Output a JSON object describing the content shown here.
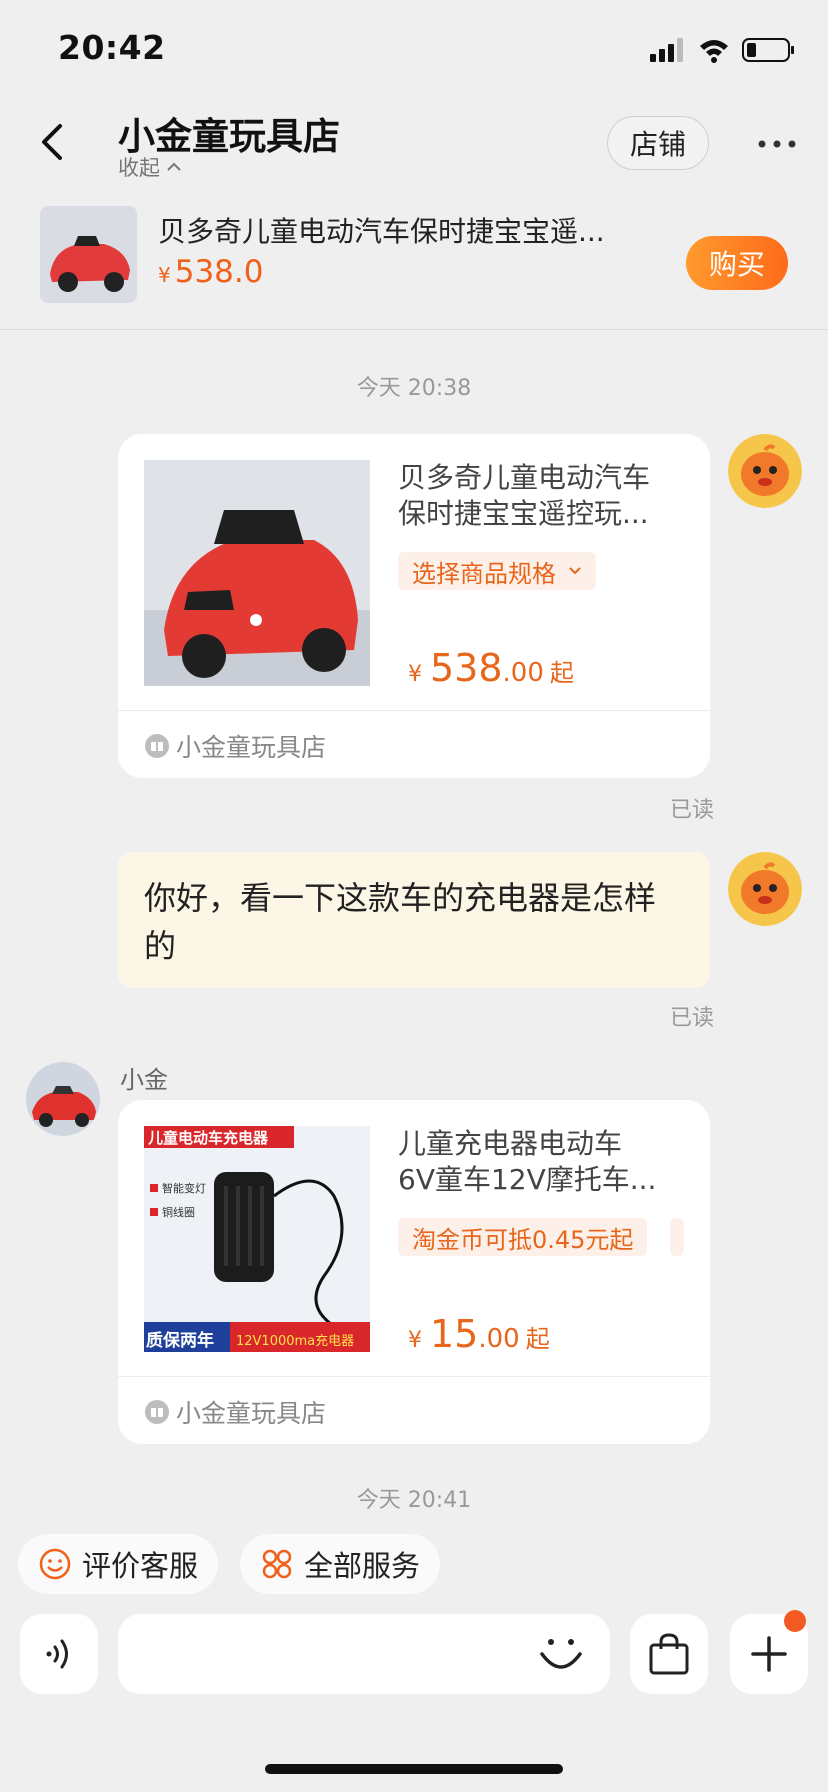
{
  "status_bar": {
    "time": "20:42"
  },
  "header": {
    "shop_name": "小金童玩具店",
    "collapse_label": "收起",
    "store_button": "店铺"
  },
  "product_bar": {
    "title": "贝多奇儿童电动汽车保时捷宝宝遥...",
    "price_currency": "¥",
    "price": "538.0",
    "buy_button": "购买"
  },
  "messages": {
    "time_1": "今天 20:38",
    "card_1": {
      "title_line1": "贝多奇儿童电动汽车",
      "title_line2": "保时捷宝宝遥控玩...",
      "tag": "选择商品规格",
      "currency": "¥",
      "price_int": "538",
      "price_dec": ".00",
      "price_suffix": "起",
      "shop": "小金童玩具店"
    },
    "read_1": "已读",
    "text_1": "你好，看一下这款车的充电器是怎样的",
    "read_2": "已读",
    "sender_name": "小金",
    "card_2": {
      "title_line1": "儿童充电器电动车",
      "title_line2": "6V童车12V摩托车...",
      "tag": "淘金币可抵0.45元起",
      "currency": "¥",
      "price_int": "15",
      "price_dec": ".00",
      "price_suffix": "起",
      "shop": "小金童玩具店",
      "image_banner": "儿童电动车充电器",
      "image_feature_1": "智能变灯",
      "image_feature_2": "铜线圈",
      "image_footer_left": "质保两年",
      "image_footer_right": "12V1000ma充电器"
    },
    "time_2": "今天 20:41"
  },
  "quick_actions": {
    "rate_service": "评价客服",
    "all_services": "全部服务"
  },
  "input": {
    "placeholder": ""
  },
  "colors": {
    "accent": "#f0601a",
    "bubble": "#fcf6e6",
    "background": "#efefef"
  }
}
